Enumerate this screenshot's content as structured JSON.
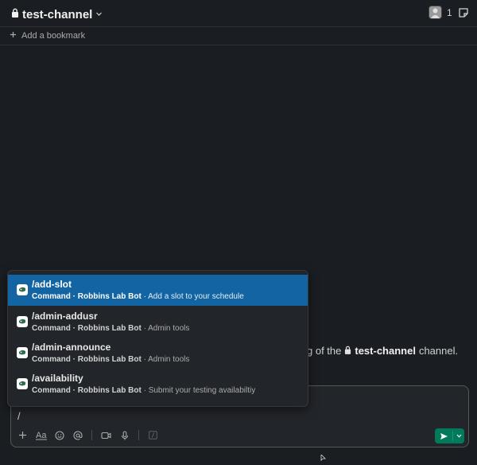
{
  "header": {
    "channel_name": "test-channel",
    "member_count": "1"
  },
  "bookmarks": {
    "add_label": "Add a bookmark"
  },
  "intro": {
    "prefix": "g of the",
    "channel_name": "test-channel",
    "suffix": "channel."
  },
  "composer": {
    "text": "/"
  },
  "commands": [
    {
      "name": "/add-slot",
      "type": "Command",
      "app": "Robbins Lab Bot",
      "description": "Add a slot to your schedule"
    },
    {
      "name": "/admin-addusr",
      "type": "Command",
      "app": "Robbins Lab Bot",
      "description": "Admin tools"
    },
    {
      "name": "/admin-announce",
      "type": "Command",
      "app": "Robbins Lab Bot",
      "description": "Admin tools"
    },
    {
      "name": "/availability",
      "type": "Command",
      "app": "Robbins Lab Bot",
      "description": "Submit your testing availabiltiy"
    }
  ],
  "colors": {
    "background": "#1a1d21",
    "selected": "#1264a3",
    "send": "#007a5a"
  }
}
